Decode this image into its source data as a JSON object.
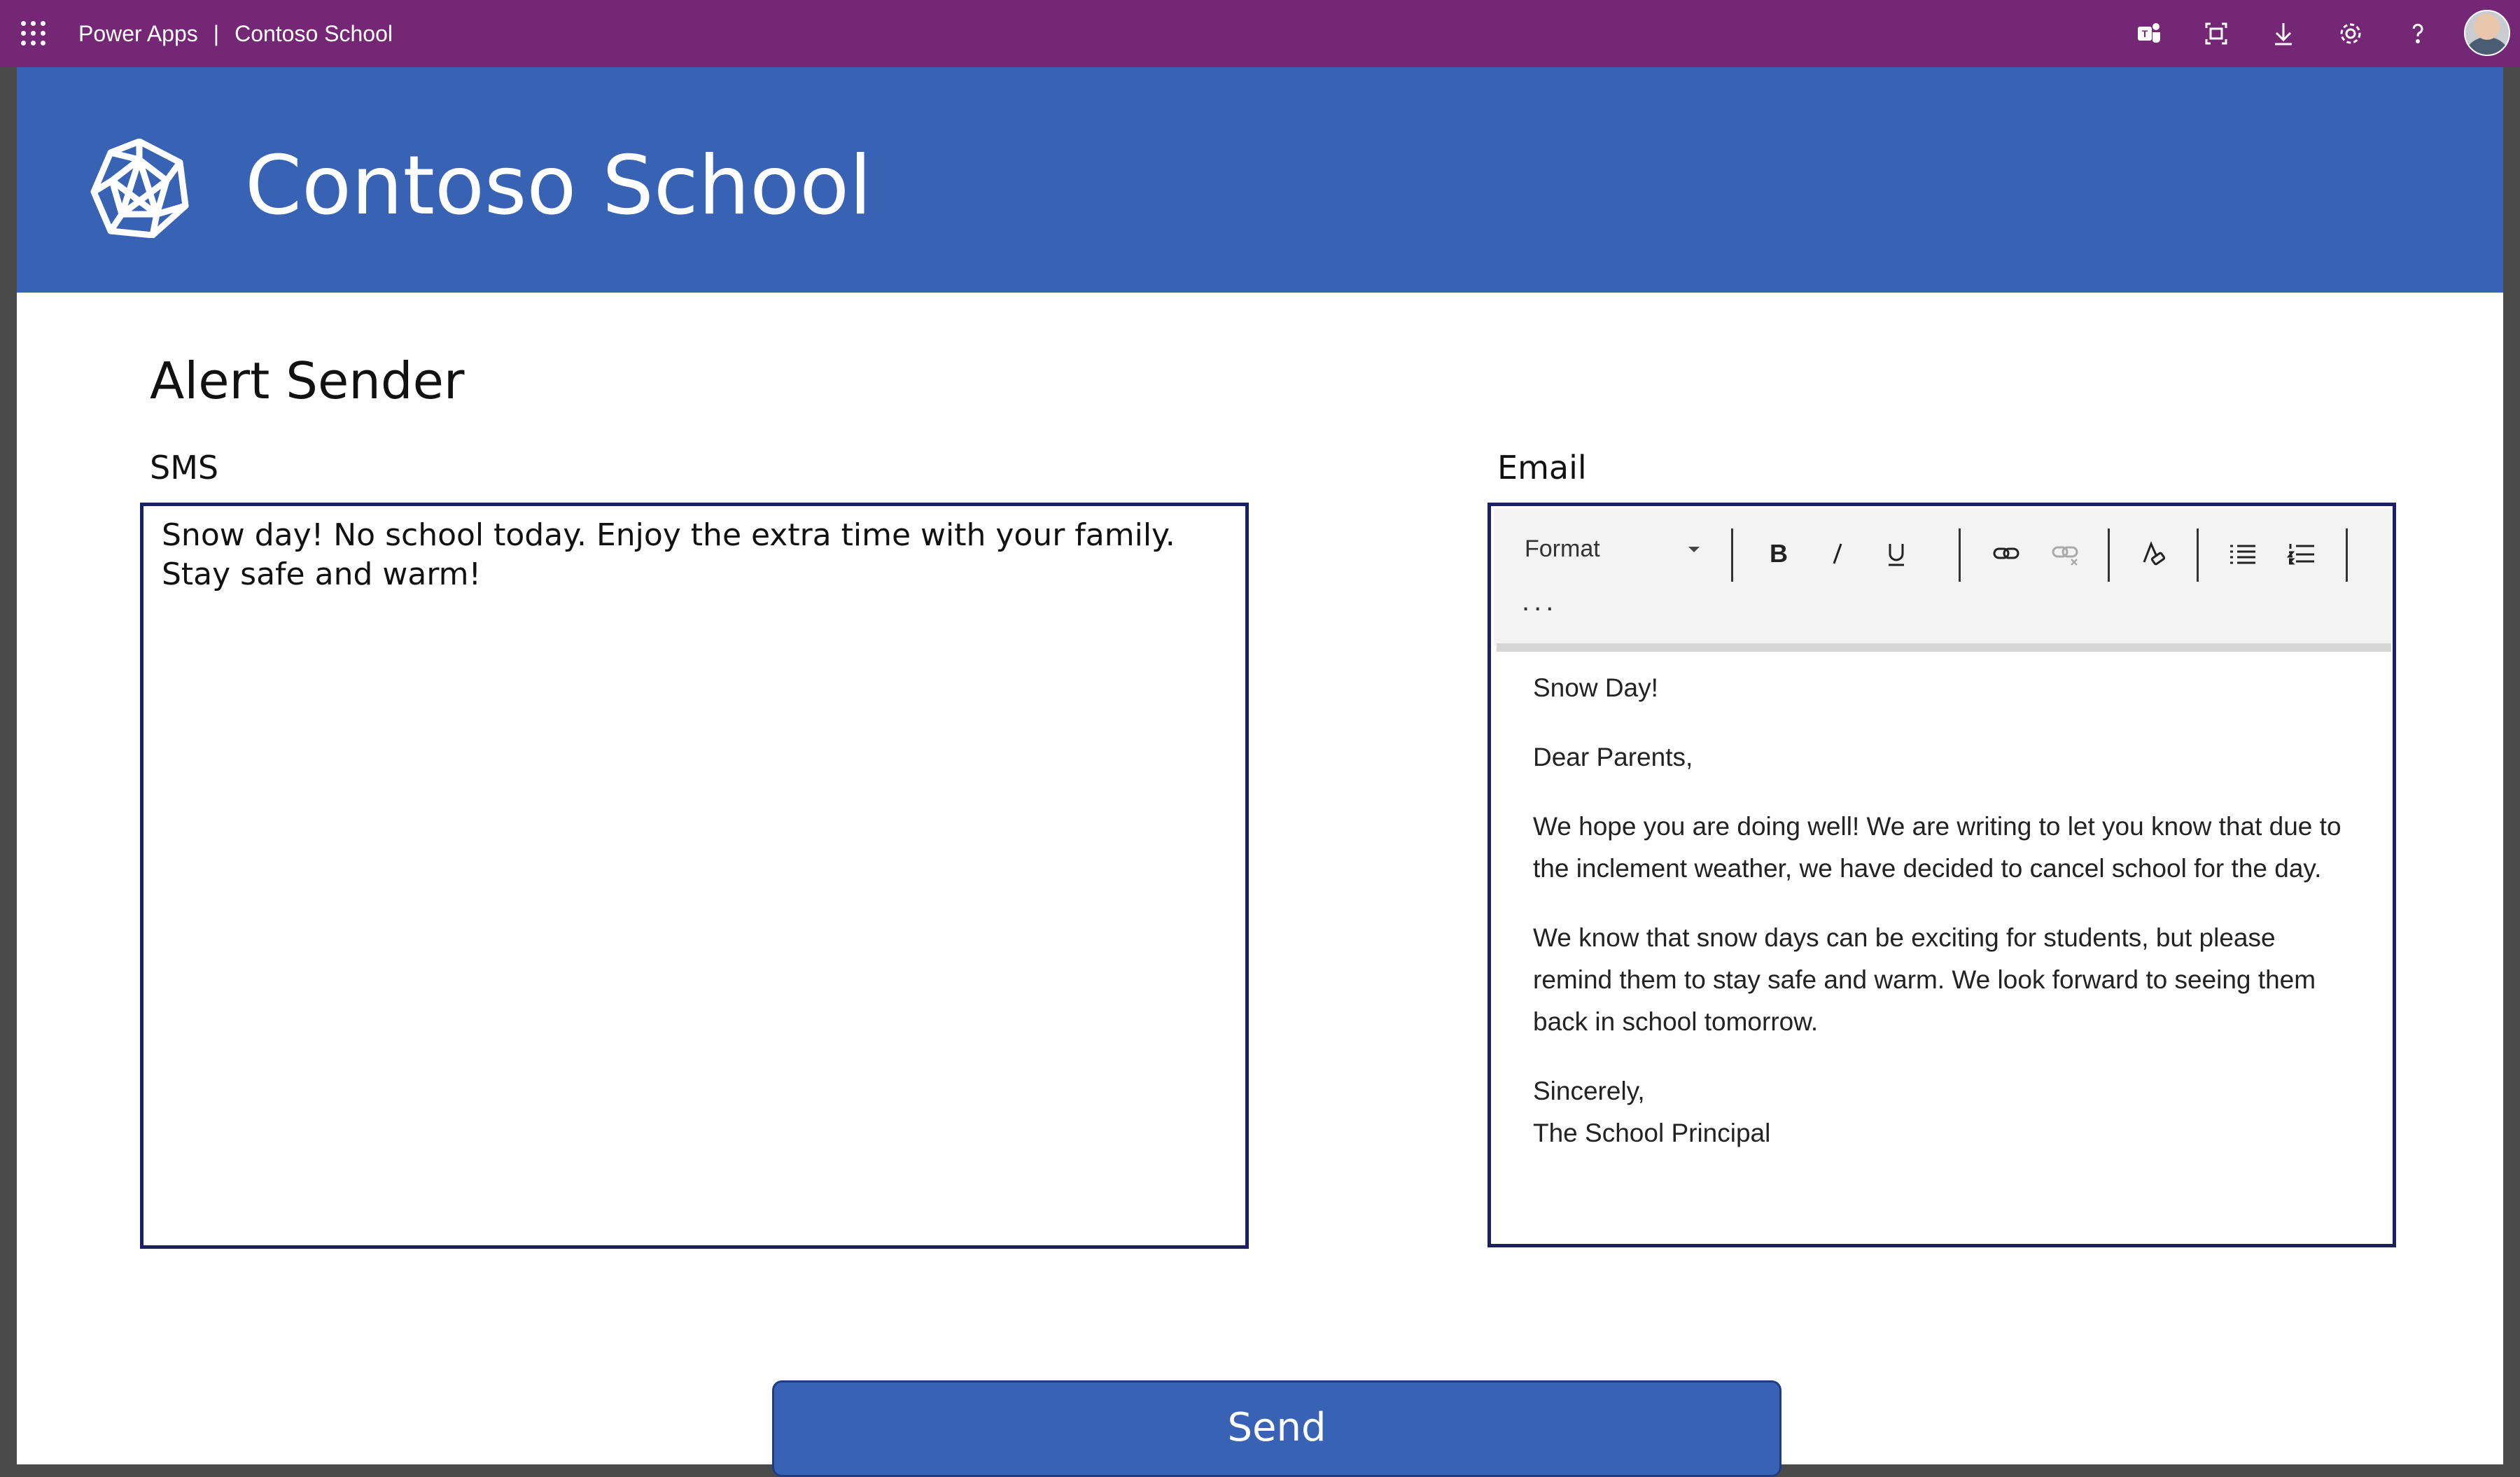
{
  "topbar": {
    "product": "Power Apps",
    "separator": "|",
    "app_title": "Contoso School",
    "icons": [
      "teams-icon",
      "fit-screen-icon",
      "download-icon",
      "settings-icon",
      "help-icon"
    ]
  },
  "header": {
    "app_name": "Contoso School",
    "logo_icon": "polyhedron-logo-icon",
    "background": "#3862b4"
  },
  "main": {
    "title": "Alert Sender",
    "sms": {
      "label": "SMS",
      "value": "Snow day! No school today. Enjoy the extra time with your family. Stay safe and warm!"
    },
    "email": {
      "label": "Email",
      "toolbar": {
        "format_label": "Format",
        "more_label": "...",
        "buttons": [
          "bold-icon",
          "italic-icon",
          "underline-icon",
          "link-icon",
          "unlink-icon",
          "clear-format-icon",
          "bulleted-list-icon",
          "numbered-list-icon"
        ]
      },
      "body": {
        "subject_line": "Snow Day!",
        "greeting": "Dear Parents,",
        "paragraph1": "We hope you are doing well! We are writing to let you know that due to the inclement weather, we have decided to cancel school for the day.",
        "paragraph2": "We know that snow days can be exciting for students, but please remind them to stay safe and warm. We look forward to seeing them back in school tomorrow.",
        "closing": "Sincerely,",
        "signature": "The School Principal"
      }
    },
    "send_label": "Send"
  },
  "colors": {
    "topbar": "#742774",
    "accent": "#3862b4",
    "input_border": "#1b1f6b"
  }
}
